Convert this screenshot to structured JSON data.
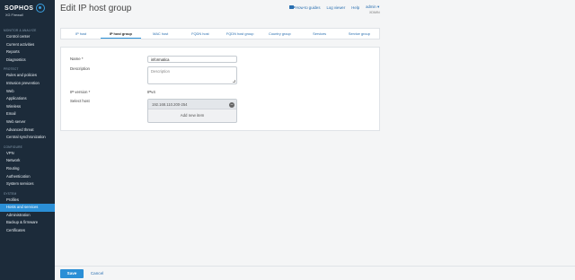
{
  "sidebar": {
    "logo_text": "SOPHOS",
    "logo_sub": "XG Firewall",
    "sections": [
      {
        "title": "MONITOR & ANALYZE",
        "items": [
          "Control center",
          "Current activities",
          "Reports",
          "Diagnostics"
        ]
      },
      {
        "title": "PROTECT",
        "items": [
          "Rules and policies",
          "Intrusion prevention",
          "Web",
          "Applications",
          "Wireless",
          "Email",
          "Web server",
          "Advanced threat",
          "Central synchronization"
        ]
      },
      {
        "title": "CONFIGURE",
        "items": [
          "VPN",
          "Network",
          "Routing",
          "Authentication",
          "System services"
        ]
      },
      {
        "title": "SYSTEM",
        "items": [
          "Profiles",
          "Hosts and services",
          "Administration",
          "Backup & firmware",
          "Certificates"
        ]
      }
    ],
    "active_item": "Hosts and services"
  },
  "header": {
    "title": "Edit IP host group",
    "links": {
      "guides": "How-to guides",
      "log_viewer": "Log viewer",
      "help": "Help",
      "admin": "admin ▾"
    },
    "admin_sub": "XDMIN"
  },
  "tabs": [
    "IP host",
    "IP host group",
    "MAC host",
    "FQDN host",
    "FQDN host group",
    "Country group",
    "Services",
    "Service group"
  ],
  "active_tab": "IP host group",
  "form": {
    "name_label": "Name *",
    "name_value": "informatica",
    "description_label": "Description",
    "description_placeholder": "Description",
    "ip_version_label": "IP version *",
    "ip_version_value": "IPv4",
    "select_host_label": "Select host",
    "host_entry": "192.168.110.200-254",
    "add_new_item": "Add new item"
  },
  "footer": {
    "save": "Save",
    "cancel": "Cancel"
  }
}
